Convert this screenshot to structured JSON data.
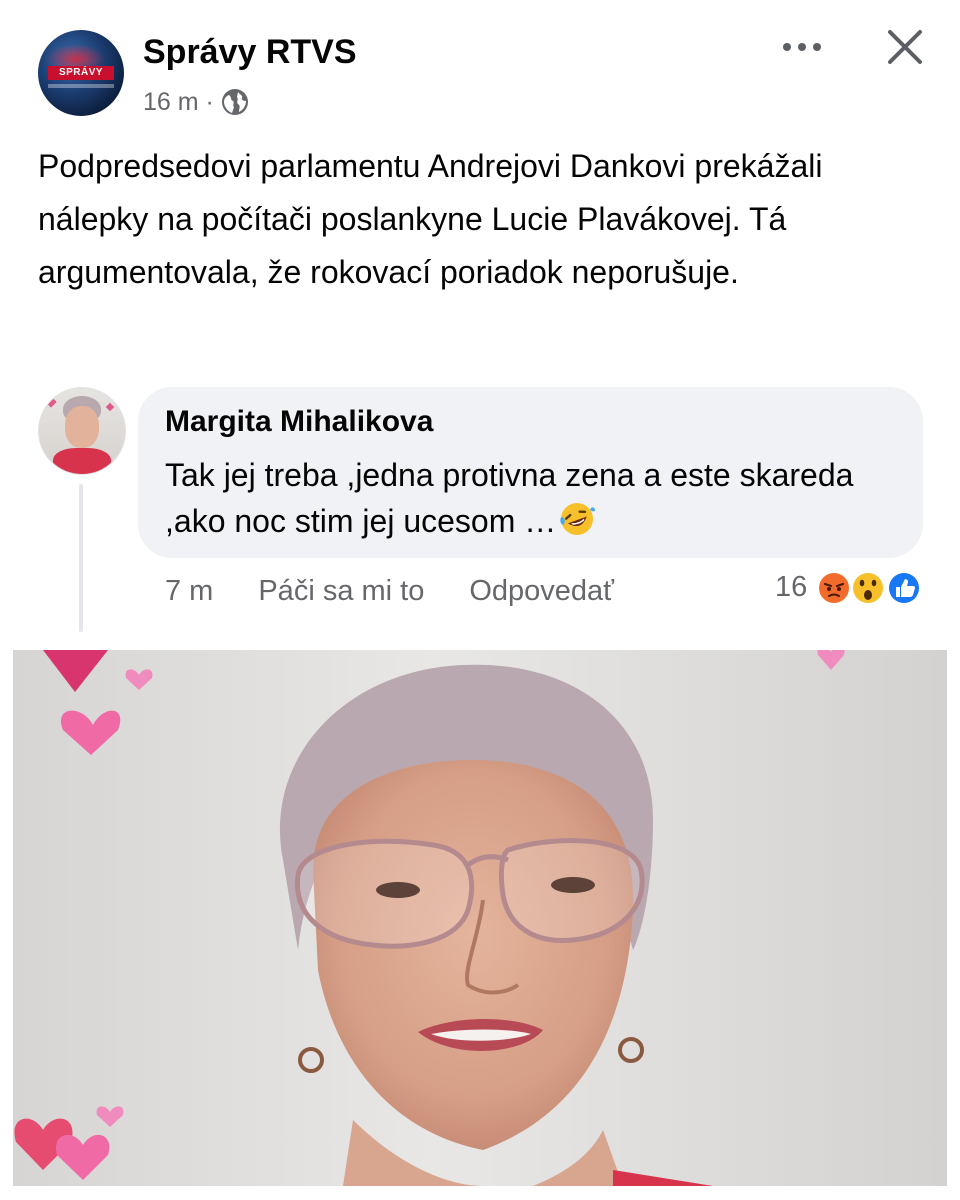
{
  "post": {
    "page_name": "Správy RTVS",
    "avatar_badge": "SPRÁVY",
    "time": "16 m ·",
    "privacy_icon": "globe-icon",
    "text": "Podpredsedovi parlamentu Andrejovi Dankovi prekážali nálepky na počítači poslankyne Lucie Plavákovej. Tá argumentovala, že rokovací poriadok neporušuje."
  },
  "comment": {
    "author": "Margita Mihalikova",
    "text": "Tak jej treba ,jedna protivna zena a este skareda ,ako noc stim jej ucesom …",
    "emoji": "rolling-on-floor-laughing",
    "time": "7 m",
    "like_label": "Páči sa mi to",
    "reply_label": "Odpovedať",
    "reaction_count": "16",
    "reaction_icons": [
      "angry-icon",
      "wow-icon",
      "like-icon"
    ]
  },
  "colors": {
    "text_primary": "#050505",
    "text_secondary": "#65676b",
    "bubble_bg": "#f0f2f5",
    "like_blue": "#1877f2"
  }
}
